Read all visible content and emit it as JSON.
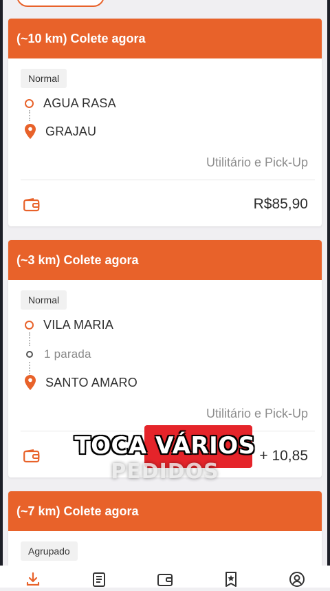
{
  "orders": [
    {
      "header": "(~10 km) Colete agora",
      "tag": "Normal",
      "origin": "AGUA RASA",
      "middle": "",
      "destination": "GRAJAU",
      "vehicle": "Utilitário e Pick-Up",
      "price": "R$85,90"
    },
    {
      "header": "(~3 km) Colete agora",
      "tag": "Normal",
      "origin": "VILA MARIA",
      "middle": "1 parada",
      "destination": "SANTO AMARO",
      "vehicle": "Utilitário e Pick-Up",
      "price": "+ 10,85"
    },
    {
      "header": "(~7 km) Colete agora",
      "tag": "Agrupado"
    }
  ],
  "caption": {
    "line1": "TOCA VÁRIOS",
    "line2": "PEDIDOS"
  },
  "nav": {
    "items": [
      "download-icon",
      "orders-list-icon",
      "wallet-icon",
      "star-badge-icon",
      "profile-icon"
    ]
  },
  "colors": {
    "accent": "#e8622a",
    "caption_highlight": "#e5242a"
  }
}
